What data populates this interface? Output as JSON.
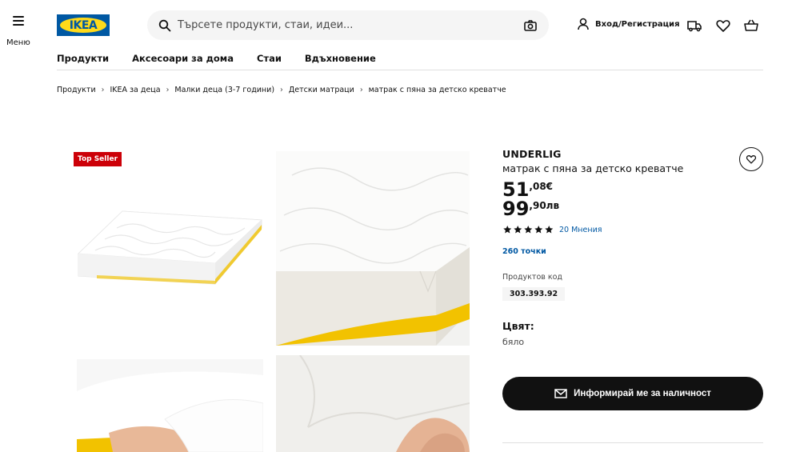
{
  "header": {
    "menu_label": "Меню",
    "logo_text": "IKEA",
    "search_placeholder": "Търсете продукти, стаи, идеи...",
    "login_label": "Вход/Регистрация"
  },
  "nav": [
    "Продукти",
    "Аксесоари за дома",
    "Стаи",
    "Вдъхновение"
  ],
  "breadcrumb": [
    "Продукти",
    "IKEA за деца",
    "Малки деца (3-7 години)",
    "Детски матраци",
    "матрак с пяна за детско креватче"
  ],
  "gallery": {
    "badge": "Top Seller"
  },
  "product": {
    "name": "UNDERLIG",
    "description": "матрак с пяна за детско креватче",
    "price_eur_int": "51",
    "price_eur_dec": ",08€",
    "price_bgn_int": "99",
    "price_bgn_dec": ",90лв",
    "rating": 5,
    "reviews": "20 Мнения",
    "points": "260 точки",
    "code_label": "Продуктов код",
    "code": "303.393.92",
    "color_label": "Цвят:",
    "color_value": "бяло",
    "notify_label": "Информирай ме за наличност"
  },
  "colors": {
    "ikea_blue": "#0058a3",
    "ikea_yellow": "#ffda1a",
    "badge_red": "#cc0008",
    "link_blue": "#0058a3"
  }
}
